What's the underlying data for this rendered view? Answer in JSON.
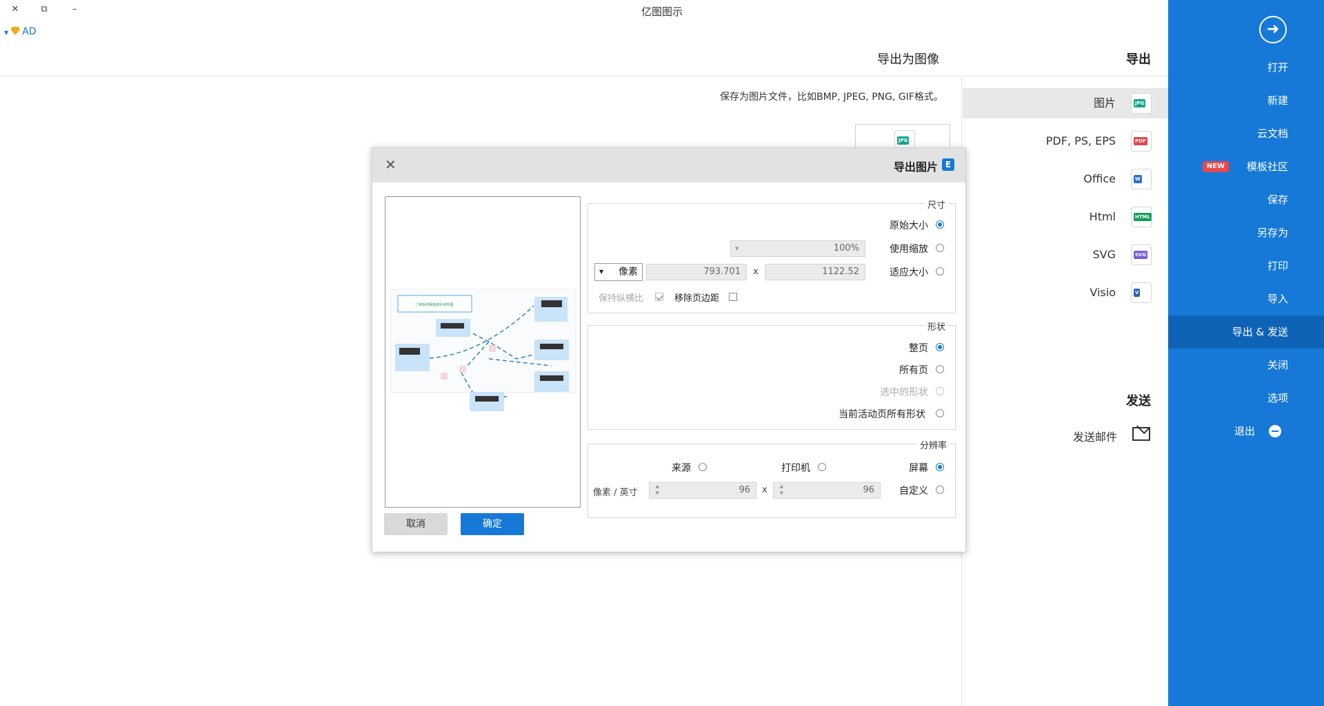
{
  "app": {
    "title": "亿图图示",
    "ad_label": "AD",
    "window_controls": {
      "close": "✕",
      "restore": "⧉",
      "minimize": "–"
    }
  },
  "sidebar": {
    "back_icon": "arrow-right-circle-icon",
    "items": [
      {
        "label": "打开"
      },
      {
        "label": "新建"
      },
      {
        "label": "云文档"
      },
      {
        "label": "模板社区",
        "badge": "NEW"
      },
      {
        "label": "保存"
      },
      {
        "label": "另存为"
      },
      {
        "label": "打印"
      },
      {
        "label": "导入"
      },
      {
        "label": "导出 & 发送",
        "active": true
      },
      {
        "label": "关闭"
      },
      {
        "label": "选项"
      },
      {
        "label": "退出"
      }
    ]
  },
  "header": {
    "export_title": "导出",
    "image_title": "导出为图像"
  },
  "formats": [
    {
      "label": "图片",
      "icon": "JPG",
      "color": "#1aa38b",
      "selected": true
    },
    {
      "label": "PDF, PS, EPS",
      "icon": "PDF",
      "color": "#e0474c"
    },
    {
      "label": "Office",
      "icon": "W",
      "color": "#2b6fd1"
    },
    {
      "label": "Html",
      "icon": "HTML",
      "color": "#179c5c"
    },
    {
      "label": "SVG",
      "icon": "SVG",
      "color": "#7a5cd6"
    },
    {
      "label": "Visio",
      "icon": "V",
      "color": "#2b5fb8"
    }
  ],
  "send": {
    "title": "发送",
    "email_label": "发送邮件"
  },
  "description": "保存为图片文件，比如BMP, JPEG, PNG, GIF格式。",
  "thumb_icon": "JPG",
  "dialog": {
    "title": "导出图片",
    "logo": "E",
    "size": {
      "group": "尺寸",
      "original": "原始大小",
      "zoom": "使用缩放",
      "zoom_value": "100%",
      "fit": "适应大小",
      "width": "1122.52",
      "height": "793.701",
      "x_sep": "x",
      "unit": "像素",
      "remove_margin": "移除页边距",
      "keep_ratio": "保持纵横比"
    },
    "shape": {
      "group": "形状",
      "whole_page": "整页",
      "all_pages": "所有页",
      "selected": "选中的形状",
      "current_page": "当前活动页所有形状"
    },
    "resolution": {
      "group": "分辨率",
      "screen": "屏幕",
      "printer": "打印机",
      "source": "来源",
      "custom": "自定义",
      "dpi_x": "96",
      "dpi_y": "96",
      "x_sep": "x",
      "unit": "像素 / 英寸"
    },
    "ok": "确定",
    "cancel": "取消",
    "preview_note": "门禁系统网络拓扑结构图"
  }
}
